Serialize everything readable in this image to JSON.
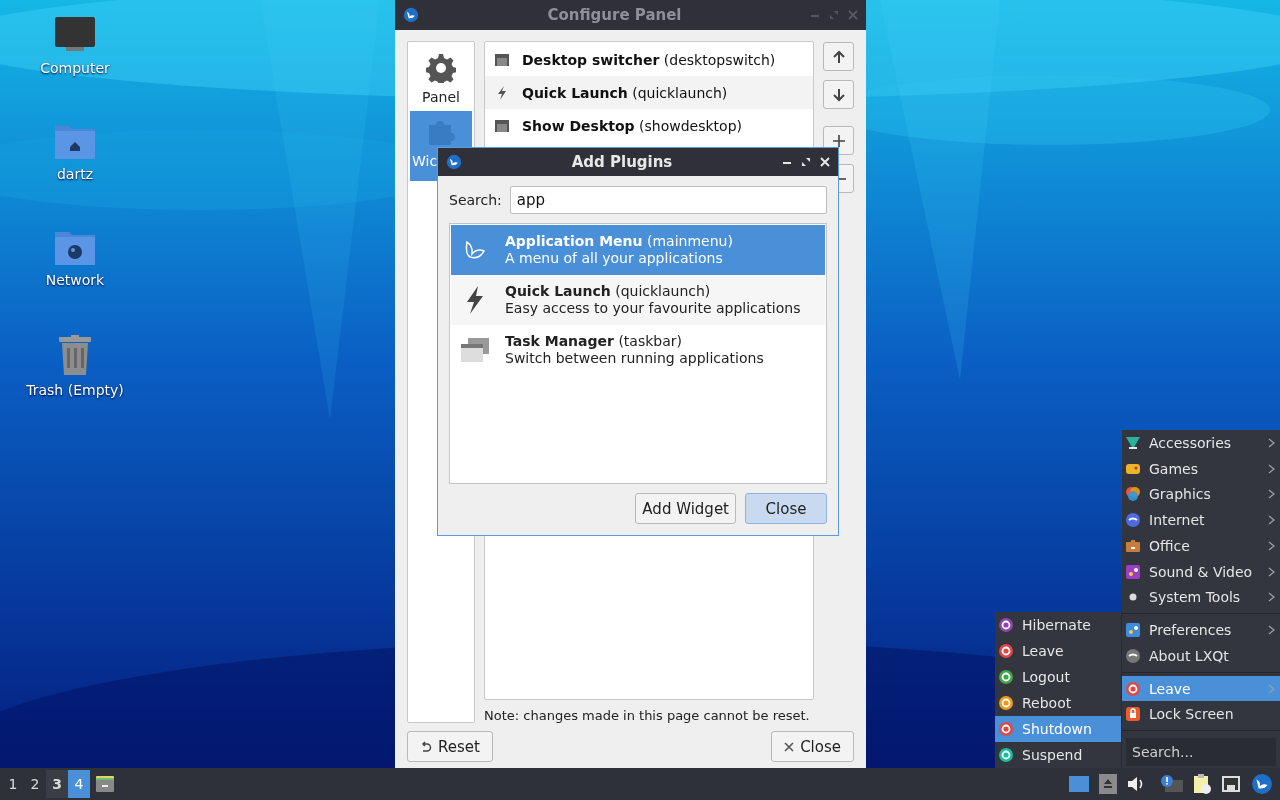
{
  "desktop": {
    "icons": [
      {
        "label": "Computer",
        "kind": "computer"
      },
      {
        "label": "dartz",
        "kind": "home"
      },
      {
        "label": "Network",
        "kind": "network"
      },
      {
        "label": "Trash (Empty)",
        "kind": "trash"
      }
    ]
  },
  "configure_panel": {
    "title": "Configure Panel",
    "sidebar": [
      {
        "label": "Panel",
        "kind": "gear",
        "selected": false
      },
      {
        "label": "Wic",
        "kind": "puzzle",
        "selected": true
      }
    ],
    "widgets": [
      {
        "text": "**Desktop switcher** (desktopswitch)",
        "kind": "window",
        "hovered": false
      },
      {
        "text": "**Quick Launch** (quicklaunch)",
        "kind": "bolt",
        "hovered": true
      },
      {
        "text": "**Show Desktop** (showdesktop)",
        "kind": "window",
        "hovered": false
      }
    ],
    "side_buttons": [
      {
        "kind": "up"
      },
      {
        "kind": "down"
      },
      {
        "kind": "plus"
      },
      {
        "kind": "minus"
      }
    ],
    "note": "Note: changes made in this page cannot be reset.",
    "buttons": [
      {
        "label": "Reset",
        "kind": "reset"
      },
      {
        "label": "Close",
        "kind": "close"
      }
    ]
  },
  "add_plugins": {
    "title": "Add Plugins",
    "search_label": "Search:",
    "search_value": "app",
    "plugins": [
      {
        "title": "**Application Menu** (mainmenu)",
        "description": "A menu of all your applications",
        "kind": "bird",
        "selected": true
      },
      {
        "title": "**Quick Launch** (quicklaunch)",
        "description": "Easy access to your favourite applications",
        "kind": "bolt",
        "selected": false
      },
      {
        "title": "**Task Manager** (taskbar)",
        "description": "Switch between running applications",
        "kind": "tasks",
        "selected": false
      }
    ],
    "buttons": [
      {
        "label": "Add Widget",
        "default": false
      },
      {
        "label": "Close",
        "default": true
      }
    ]
  },
  "main_menu": {
    "sections": [
      {
        "items": [
          {
            "label": "Accessories",
            "kind": "accessories",
            "submenu": true,
            "selected": false
          },
          {
            "label": "Games",
            "kind": "games",
            "submenu": true,
            "selected": false
          },
          {
            "label": "Graphics",
            "kind": "graphics",
            "submenu": true,
            "selected": false
          },
          {
            "label": "Internet",
            "kind": "internet",
            "submenu": true,
            "selected": false
          },
          {
            "label": "Office",
            "kind": "office",
            "submenu": true,
            "selected": false
          },
          {
            "label": "Sound & Video",
            "kind": "sound",
            "submenu": true,
            "selected": false
          },
          {
            "label": "System Tools",
            "kind": "system",
            "submenu": true,
            "selected": false
          }
        ]
      },
      {
        "items": [
          {
            "label": "Preferences",
            "kind": "preferences",
            "submenu": true,
            "selected": false
          },
          {
            "label": "About LXQt",
            "kind": "about",
            "submenu": false,
            "selected": false
          }
        ]
      },
      {
        "items": [
          {
            "label": "Leave",
            "kind": "power",
            "submenu": true,
            "selected": true
          },
          {
            "label": "Lock Screen",
            "kind": "lock",
            "submenu": false,
            "selected": false
          }
        ]
      }
    ],
    "search_placeholder": "Search..."
  },
  "leave_menu": {
    "items": [
      {
        "label": "Hibernate",
        "kind": "hibernate",
        "selected": false
      },
      {
        "label": "Leave",
        "kind": "power",
        "selected": false
      },
      {
        "label": "Logout",
        "kind": "logout",
        "selected": false
      },
      {
        "label": "Reboot",
        "kind": "reboot",
        "selected": false
      },
      {
        "label": "Shutdown",
        "kind": "power",
        "selected": true
      },
      {
        "label": "Suspend",
        "kind": "suspend",
        "selected": false
      }
    ]
  },
  "taskbar": {
    "desktops": [
      {
        "label": "1",
        "selected": false,
        "hovered": false
      },
      {
        "label": "2",
        "selected": false,
        "hovered": false
      },
      {
        "label": "3",
        "selected": false,
        "hovered": true
      },
      {
        "label": "4",
        "selected": true,
        "hovered": false
      }
    ]
  }
}
